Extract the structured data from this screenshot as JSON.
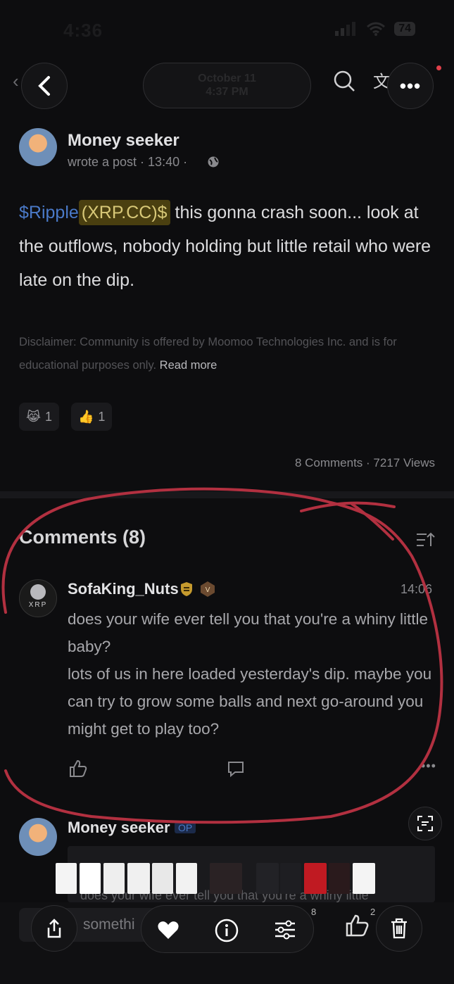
{
  "status_bar": {
    "time": "4:36",
    "battery": "74"
  },
  "header": {
    "date": "October 11",
    "time": "4:37 PM",
    "translate_glyph": "文"
  },
  "post": {
    "author": "Money seeker",
    "meta": "wrote a post · 13:40 ·",
    "cashtag": "$Ripple",
    "ticker": "(XRP.CC)$",
    "body": " this gonna crash soon... look at the outflows, nobody holding but little retail who were late on the dip.",
    "disclaimer": "Disclaimer: Community is offered by Moomoo Technologies Inc. and is for educational purposes only.",
    "read_more": "Read more",
    "reactions": [
      {
        "emoji": "😹",
        "count": "1"
      },
      {
        "emoji": "👍",
        "count": "1"
      }
    ],
    "stats": "8 Comments · 7217 Views"
  },
  "comments": {
    "title": "Comments (8)",
    "first": {
      "user": "SofaKing_Nuts",
      "time": "14:06",
      "avatar_label": "XRP",
      "text1": "does your wife ever tell you that you're a whiny little baby?",
      "text2": "lots of us in here loaded yesterday's dip. maybe you can try to grow some balls and next go-around you might get to play too?"
    },
    "second": {
      "user": "Money seeker",
      "badge": "OP",
      "quoted": "does your wife ever tell you that you're a whiny little"
    }
  },
  "bottom": {
    "input_placeholder": "somethi",
    "comment_count": "8",
    "like_count": "2"
  },
  "colors": {
    "accent": "#4a79c7",
    "annotation": "#b23040"
  }
}
